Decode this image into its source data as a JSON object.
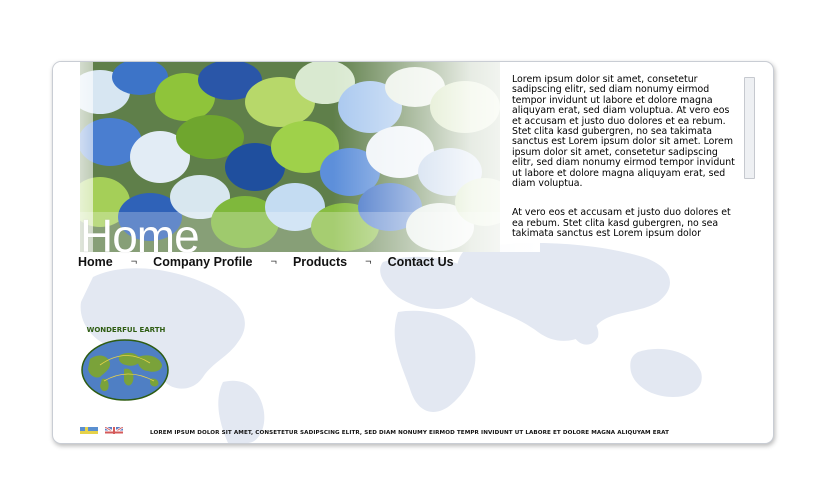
{
  "page": {
    "title": "Home"
  },
  "nav": {
    "items": [
      {
        "label": "Home"
      },
      {
        "label": "Company Profile"
      },
      {
        "label": "Products"
      },
      {
        "label": "Contact Us"
      }
    ],
    "separator": "¬"
  },
  "content": {
    "paragraphs": [
      "Lorem ipsum dolor sit amet, consetetur sadipscing elitr,  sed diam nonumy eirmod tempor invidunt ut labore et dolore magna aliquyam erat, sed diam voluptua. At vero eos et accusam et justo duo dolores et ea rebum. Stet clita kasd gubergren, no sea takimata sanctus est Lorem ipsum dolor sit amet. Lorem ipsum dolor sit amet, consetetur sadipscing elitr,  sed diam nonumy eirmod tempor invidunt ut labore et dolore magna aliquyam erat, sed diam voluptua.",
      "At vero eos et accusam et justo duo dolores et ea rebum. Stet clita kasd gubergren, no sea takimata sanctus est Lorem ipsum dolor"
    ]
  },
  "logo": {
    "text": "WONDERFUL EARTH"
  },
  "flags": [
    {
      "name": "sweden-flag-icon"
    },
    {
      "name": "uk-flag-icon"
    }
  ],
  "footer": {
    "text": "LOREM IPSUM DOLOR SIT AMET, CONSETETUR SADIPSCING ELITR, SED DIAM NONUMY EIRMOD TEMPR INVIDUNT UT LABORE ET DOLORE MAGNA ALIQUYAM ERAT"
  },
  "colors": {
    "map": "#dfe4ef",
    "logo_green": "#2e5c12",
    "globe_blue": "#4f7fc4"
  }
}
